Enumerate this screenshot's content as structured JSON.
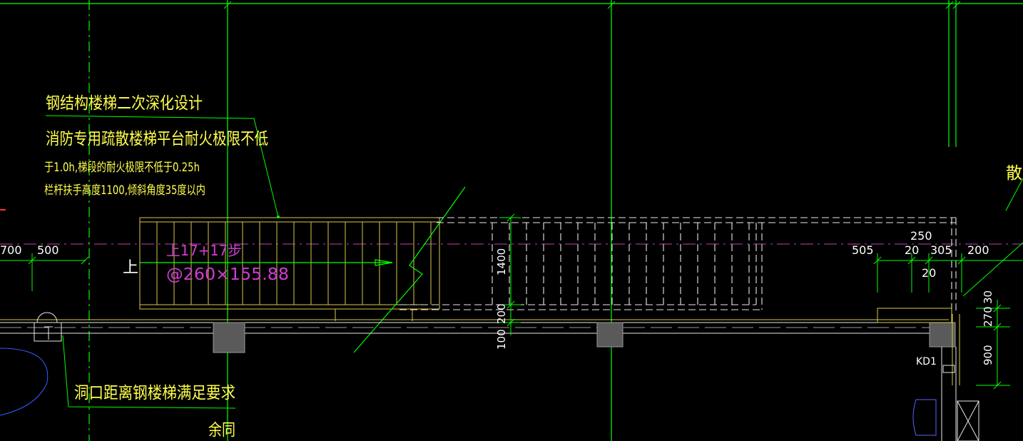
{
  "notes": {
    "steel_stair": "钢结构楼梯二次深化设计",
    "fire_line1": "消防专用疏散楼梯平台耐火极限不低",
    "fire_line2": "于1.0h,梯段的耐火极限不低于0.25h",
    "rail_line": "栏杆扶手高度1100,倾斜角度35度以内",
    "opening_note": "洞口距离钢楼梯满足要求",
    "same_note": "余同",
    "edge_label": "散"
  },
  "stair": {
    "up_label": "上",
    "steps": "上17+17步",
    "tread": "@260×155.88"
  },
  "dimensions": {
    "d700": "700",
    "d500": "500",
    "d1400": "1400",
    "d200": "200",
    "d100": "100",
    "d505": "505",
    "d20a": "20",
    "d305": "305",
    "d200r": "200",
    "d250": "250",
    "d20b": "20",
    "d30": "30",
    "d270": "270",
    "d900": "900"
  },
  "tags": {
    "kd1": "KD1"
  },
  "colors": {
    "background": "#000000",
    "green": "#00ff00",
    "yellow": "#ffff4d",
    "magenta": "#d23cd2",
    "white": "#ffffff",
    "grey": "#5a5a5a"
  }
}
